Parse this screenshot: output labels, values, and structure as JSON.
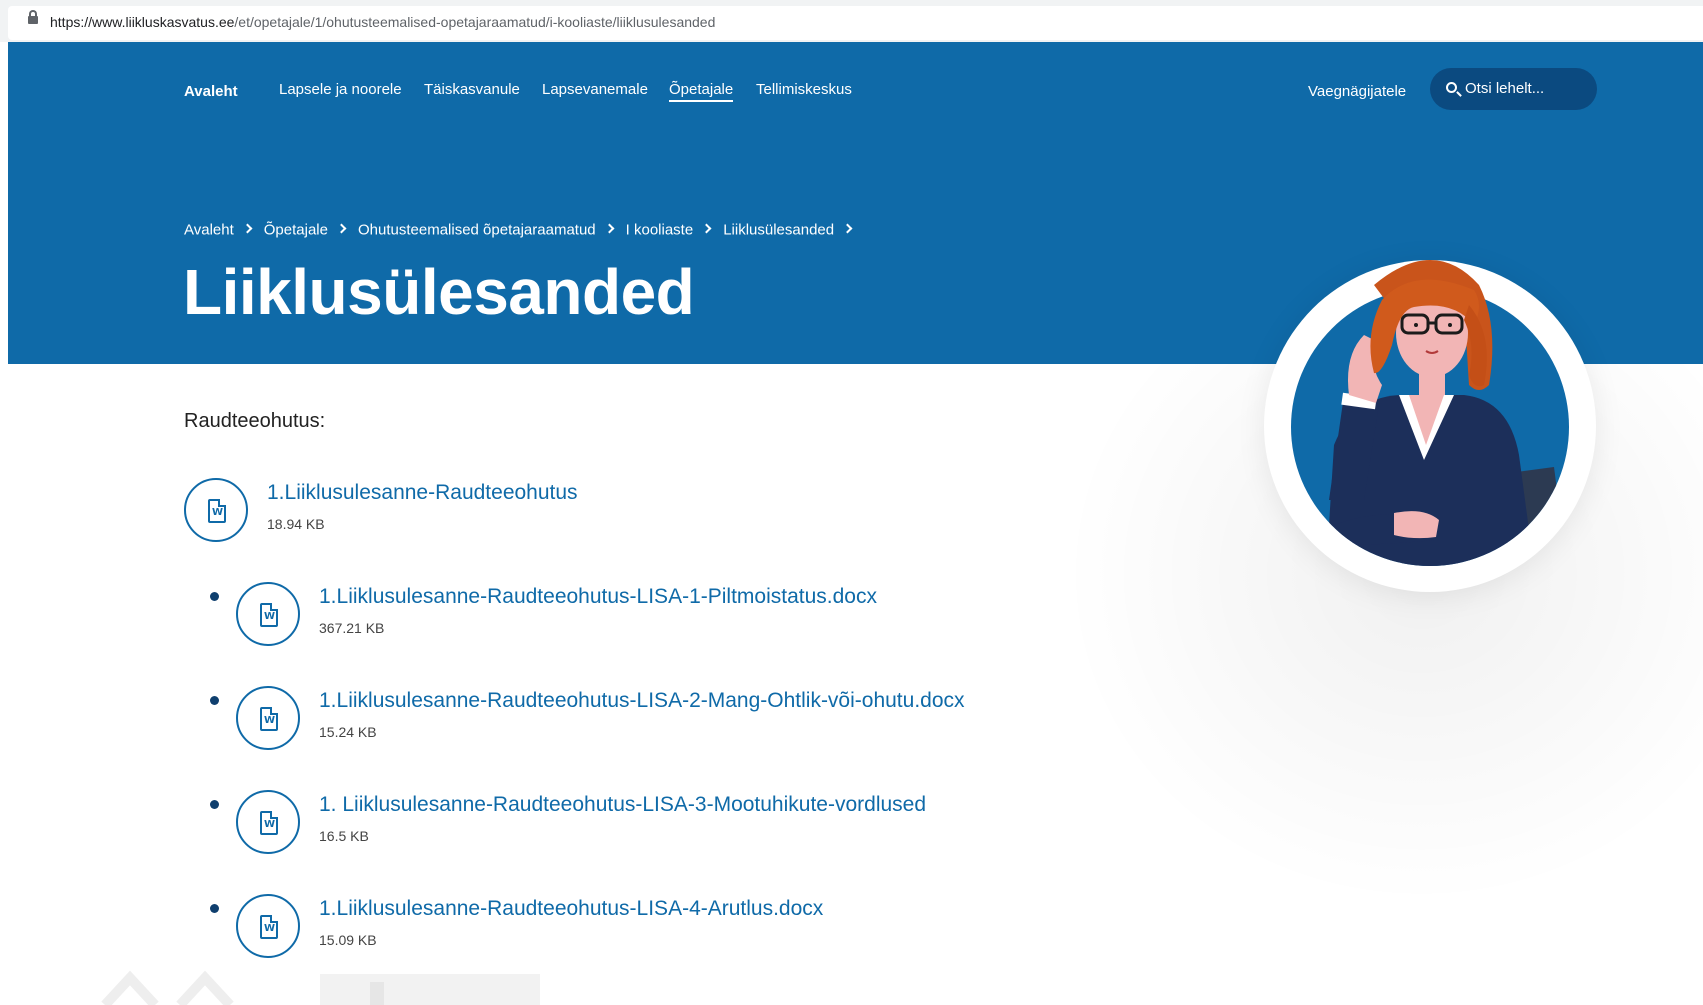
{
  "browser": {
    "url_host": "https://www.liikluskasvatus.ee",
    "url_path": "/et/opetajale/1/ohutusteemalised-opetajaraamatud/i-kooliaste/liiklusulesanded"
  },
  "nav": {
    "home": "Avaleht",
    "items": [
      "Lapsele ja noorele",
      "Täiskasvanule",
      "Lapsevanemale",
      "Õpetajale",
      "Tellimiskeskus"
    ],
    "active": "Õpetajale",
    "hearing_impaired": "Vaegnägijatele",
    "search_placeholder": "Otsi lehelt..."
  },
  "breadcrumb": [
    "Avaleht",
    "Õpetajale",
    "Ohutusteemalised õpetajaraamatud",
    "I kooliaste",
    "Liiklusülesanded"
  ],
  "page_title": "Liiklusülesanded",
  "section_label": "Raudteeohutus:",
  "main_file": {
    "name": "1.Liiklusulesanne-Raudteeohutus",
    "size": "18.94 KB"
  },
  "attachments": [
    {
      "name": "1.Liiklusulesanne-Raudteeohutus-LISA-1-Piltmoistatus.docx",
      "size": "367.21 KB"
    },
    {
      "name": "1.Liiklusulesanne-Raudteeohutus-LISA-2-Mang-Ohtlik-või-ohutu.docx",
      "size": "15.24 KB"
    },
    {
      "name": "1. Liiklusulesanne-Raudteeohutus-LISA-3-Mootuhikute-vordlused",
      "size": "16.5 KB"
    },
    {
      "name": "1.Liiklusulesanne-Raudteeohutus-LISA-4-Arutlus.docx",
      "size": "15.09 KB"
    }
  ],
  "colors": {
    "hero_blue": "#0f6aa8",
    "search_bg": "#0b4a80",
    "link": "#0f6aa8"
  },
  "icons": {
    "file": "word-document-icon",
    "search": "search-icon",
    "lock": "lock-icon",
    "crumb_sep": "chevron-right-icon"
  }
}
